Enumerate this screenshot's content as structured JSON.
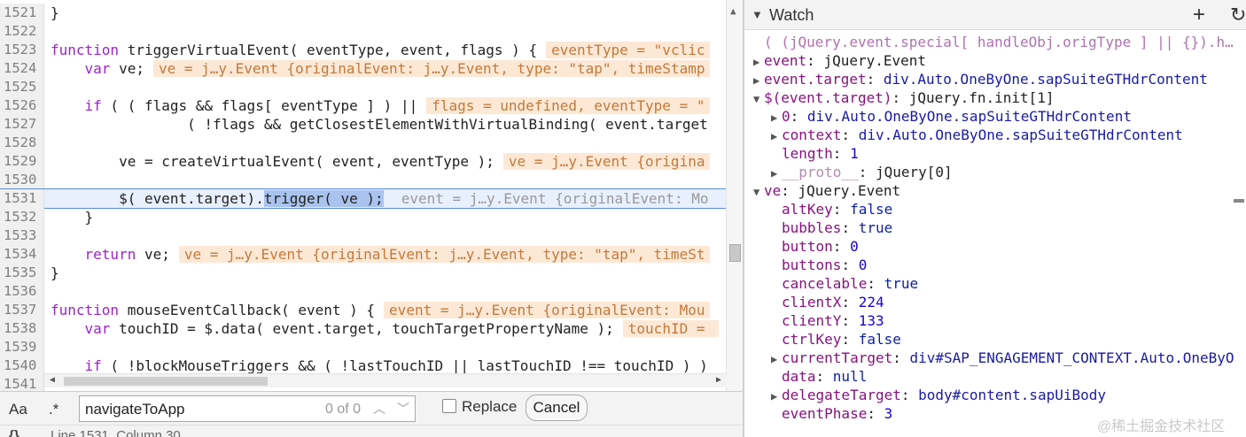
{
  "code_lines": [
    {
      "num": "1521",
      "code": "}",
      "inline": ""
    },
    {
      "num": "1522",
      "code": "",
      "inline": ""
    },
    {
      "num": "1523",
      "code": "function triggerVirtualEvent( eventType, event, flags ) {",
      "inline": "eventType = \"vclic"
    },
    {
      "num": "1524",
      "code": "    var ve;",
      "inline": "ve = j…y.Event {originalEvent: j…y.Event, type: \"tap\", timeStamp"
    },
    {
      "num": "1525",
      "code": "",
      "inline": ""
    },
    {
      "num": "1526",
      "code": "    if ( ( flags && flags[ eventType ] ) ||",
      "inline": "flags = undefined, eventType = \""
    },
    {
      "num": "1527",
      "code": "                ( !flags && getClosestElementWithVirtualBinding( event.target",
      "inline": ""
    },
    {
      "num": "1528",
      "code": "",
      "inline": ""
    },
    {
      "num": "1529",
      "code": "        ve = createVirtualEvent( event, eventType );",
      "inline": "ve = j…y.Event {origina"
    },
    {
      "num": "1530",
      "code": "",
      "inline": ""
    },
    {
      "num": "1531",
      "code": "        $( event.target).trigger( ve );",
      "inline": "event = j…y.Event {originalEvent: Mo"
    },
    {
      "num": "1532",
      "code": "    }",
      "inline": ""
    },
    {
      "num": "1533",
      "code": "",
      "inline": ""
    },
    {
      "num": "1534",
      "code": "    return ve;",
      "inline": "ve = j…y.Event {originalEvent: j…y.Event, type: \"tap\", timeSt"
    },
    {
      "num": "1535",
      "code": "}",
      "inline": ""
    },
    {
      "num": "1536",
      "code": "",
      "inline": ""
    },
    {
      "num": "1537",
      "code": "function mouseEventCallback( event ) {",
      "inline": "event = j…y.Event {originalEvent: Mou"
    },
    {
      "num": "1538",
      "code": "    var touchID = $.data( event.target, touchTargetPropertyName );",
      "inline": "touchID = "
    },
    {
      "num": "1539",
      "code": "",
      "inline": ""
    },
    {
      "num": "1540",
      "code": "    if ( !blockMouseTriggers && ( !lastTouchID || lastTouchID !== touchID ) )",
      "inline": ""
    },
    {
      "num": "1541",
      "code": "",
      "inline": ""
    }
  ],
  "search": {
    "case_label": "Aa",
    "regex_label": ".*",
    "query": "navigateToApp",
    "match_count": "0 of 0",
    "replace_label": "Replace",
    "cancel_label": "Cancel"
  },
  "status": {
    "brace": "{}",
    "position": "Line 1531, Column 30"
  },
  "watch": {
    "title": "Watch",
    "add_icon": "+",
    "refresh_icon": "↻",
    "rows": [
      {
        "indent": 0,
        "arrow": "",
        "name": "( (jQuery.event.special[ handleObj.origType ] || {}).h…",
        "value": "",
        "style": "expr"
      },
      {
        "indent": 0,
        "arrow": "▶",
        "name": "event",
        "value": "jQuery.Event",
        "style": "obj"
      },
      {
        "indent": 0,
        "arrow": "▶",
        "name": "event.target",
        "value": "div.Auto.OneByOne.sapSuiteGTHdrContent",
        "style": "str"
      },
      {
        "indent": 0,
        "arrow": "▼",
        "name": "$(event.target)",
        "value": "jQuery.fn.init[1]",
        "style": "obj"
      },
      {
        "indent": 1,
        "arrow": "▶",
        "name": "0",
        "value": "div.Auto.OneByOne.sapSuiteGTHdrContent",
        "style": "str"
      },
      {
        "indent": 1,
        "arrow": "▶",
        "name": "context",
        "value": "div.Auto.OneByOne.sapSuiteGTHdrContent",
        "style": "str"
      },
      {
        "indent": 1,
        "arrow": "",
        "name": "length",
        "value": "1",
        "style": "num"
      },
      {
        "indent": 1,
        "arrow": "▶",
        "name": "__proto__",
        "value": "jQuery[0]",
        "style": "proto"
      },
      {
        "indent": 0,
        "arrow": "▼",
        "name": "ve",
        "value": "jQuery.Event",
        "style": "obj"
      },
      {
        "indent": 1,
        "arrow": "",
        "name": "altKey",
        "value": "false",
        "style": "kw"
      },
      {
        "indent": 1,
        "arrow": "",
        "name": "bubbles",
        "value": "true",
        "style": "kw"
      },
      {
        "indent": 1,
        "arrow": "",
        "name": "button",
        "value": "0",
        "style": "num"
      },
      {
        "indent": 1,
        "arrow": "",
        "name": "buttons",
        "value": "0",
        "style": "num"
      },
      {
        "indent": 1,
        "arrow": "",
        "name": "cancelable",
        "value": "true",
        "style": "kw"
      },
      {
        "indent": 1,
        "arrow": "",
        "name": "clientX",
        "value": "224",
        "style": "num"
      },
      {
        "indent": 1,
        "arrow": "",
        "name": "clientY",
        "value": "133",
        "style": "num"
      },
      {
        "indent": 1,
        "arrow": "",
        "name": "ctrlKey",
        "value": "false",
        "style": "kw"
      },
      {
        "indent": 1,
        "arrow": "▶",
        "name": "currentTarget",
        "value": "div#SAP_ENGAGEMENT_CONTEXT.Auto.OneByO",
        "style": "str"
      },
      {
        "indent": 1,
        "arrow": "",
        "name": "data",
        "value": "null",
        "style": "kw"
      },
      {
        "indent": 1,
        "arrow": "▶",
        "name": "delegateTarget",
        "value": "body#content.sapUiBody",
        "style": "str"
      },
      {
        "indent": 1,
        "arrow": "",
        "name": "eventPhase",
        "value": "3",
        "style": "num"
      }
    ],
    "watermark": "@稀土掘金技术社区"
  }
}
